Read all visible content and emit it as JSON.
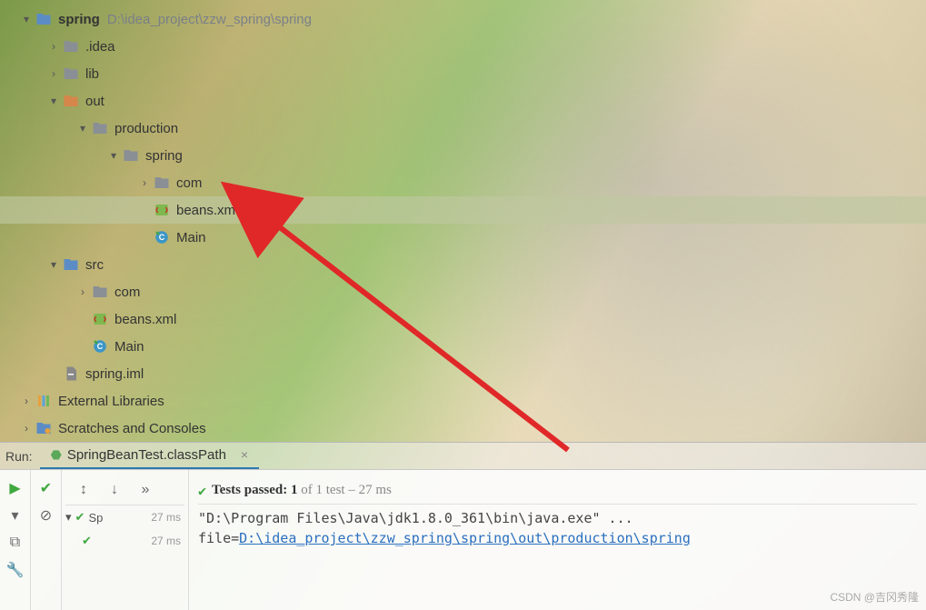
{
  "project": {
    "root": {
      "name": "spring",
      "path": "D:\\idea_project\\zzw_spring\\spring"
    },
    "tree": {
      "idea": ".idea",
      "lib": "lib",
      "out": "out",
      "production": "production",
      "out_spring": "spring",
      "out_com": "com",
      "out_beans": "beans.xml",
      "out_main": "Main",
      "src": "src",
      "src_com": "com",
      "src_beans": "beans.xml",
      "src_main": "Main",
      "spring_iml": "spring.iml",
      "external": "External Libraries",
      "scratches": "Scratches and Consoles"
    }
  },
  "run": {
    "label": "Run:",
    "tab": "SpringBeanTest.classPath"
  },
  "tests": {
    "status_prefix": "Tests passed:",
    "passed_count": "1",
    "status_suffix": "of 1 test – 27 ms",
    "node1": "Sp",
    "node1_time": "27 ms",
    "node2_time": "27 ms"
  },
  "console": {
    "line1_prefix": "\"D:\\Program Files\\Java\\jdk1.8.0_361\\bin\\java.exe\" ...",
    "line2_prefix": "file=",
    "line2_link": "D:\\idea_project\\zzw_spring\\spring\\out\\production\\spring"
  },
  "watermark": "CSDN @吉冈秀隆"
}
